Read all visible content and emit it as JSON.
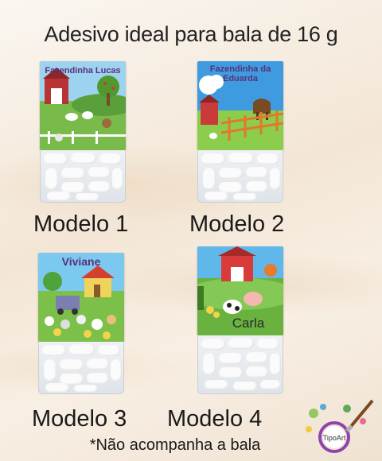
{
  "title": "Adesivo ideal para bala de 16 g",
  "models": [
    {
      "label": "Modelo 1",
      "sticker_name": "Fazendinha Lucas"
    },
    {
      "label": "Modelo 2",
      "sticker_name": "Fazendinha da Eduarda"
    },
    {
      "label": "Modelo 3",
      "sticker_name": "Viviane"
    },
    {
      "label": "Modelo 4",
      "sticker_name": "Carla"
    }
  ],
  "note": "*Não acompanha a bala",
  "logo_text": "TipoArt",
  "colors": {
    "sky": "#7fc6ea",
    "grass": "#6eb344",
    "barn": "#c23b3b",
    "name_purple": "#5a2f7c",
    "name_blue": "#1e5ea8"
  }
}
